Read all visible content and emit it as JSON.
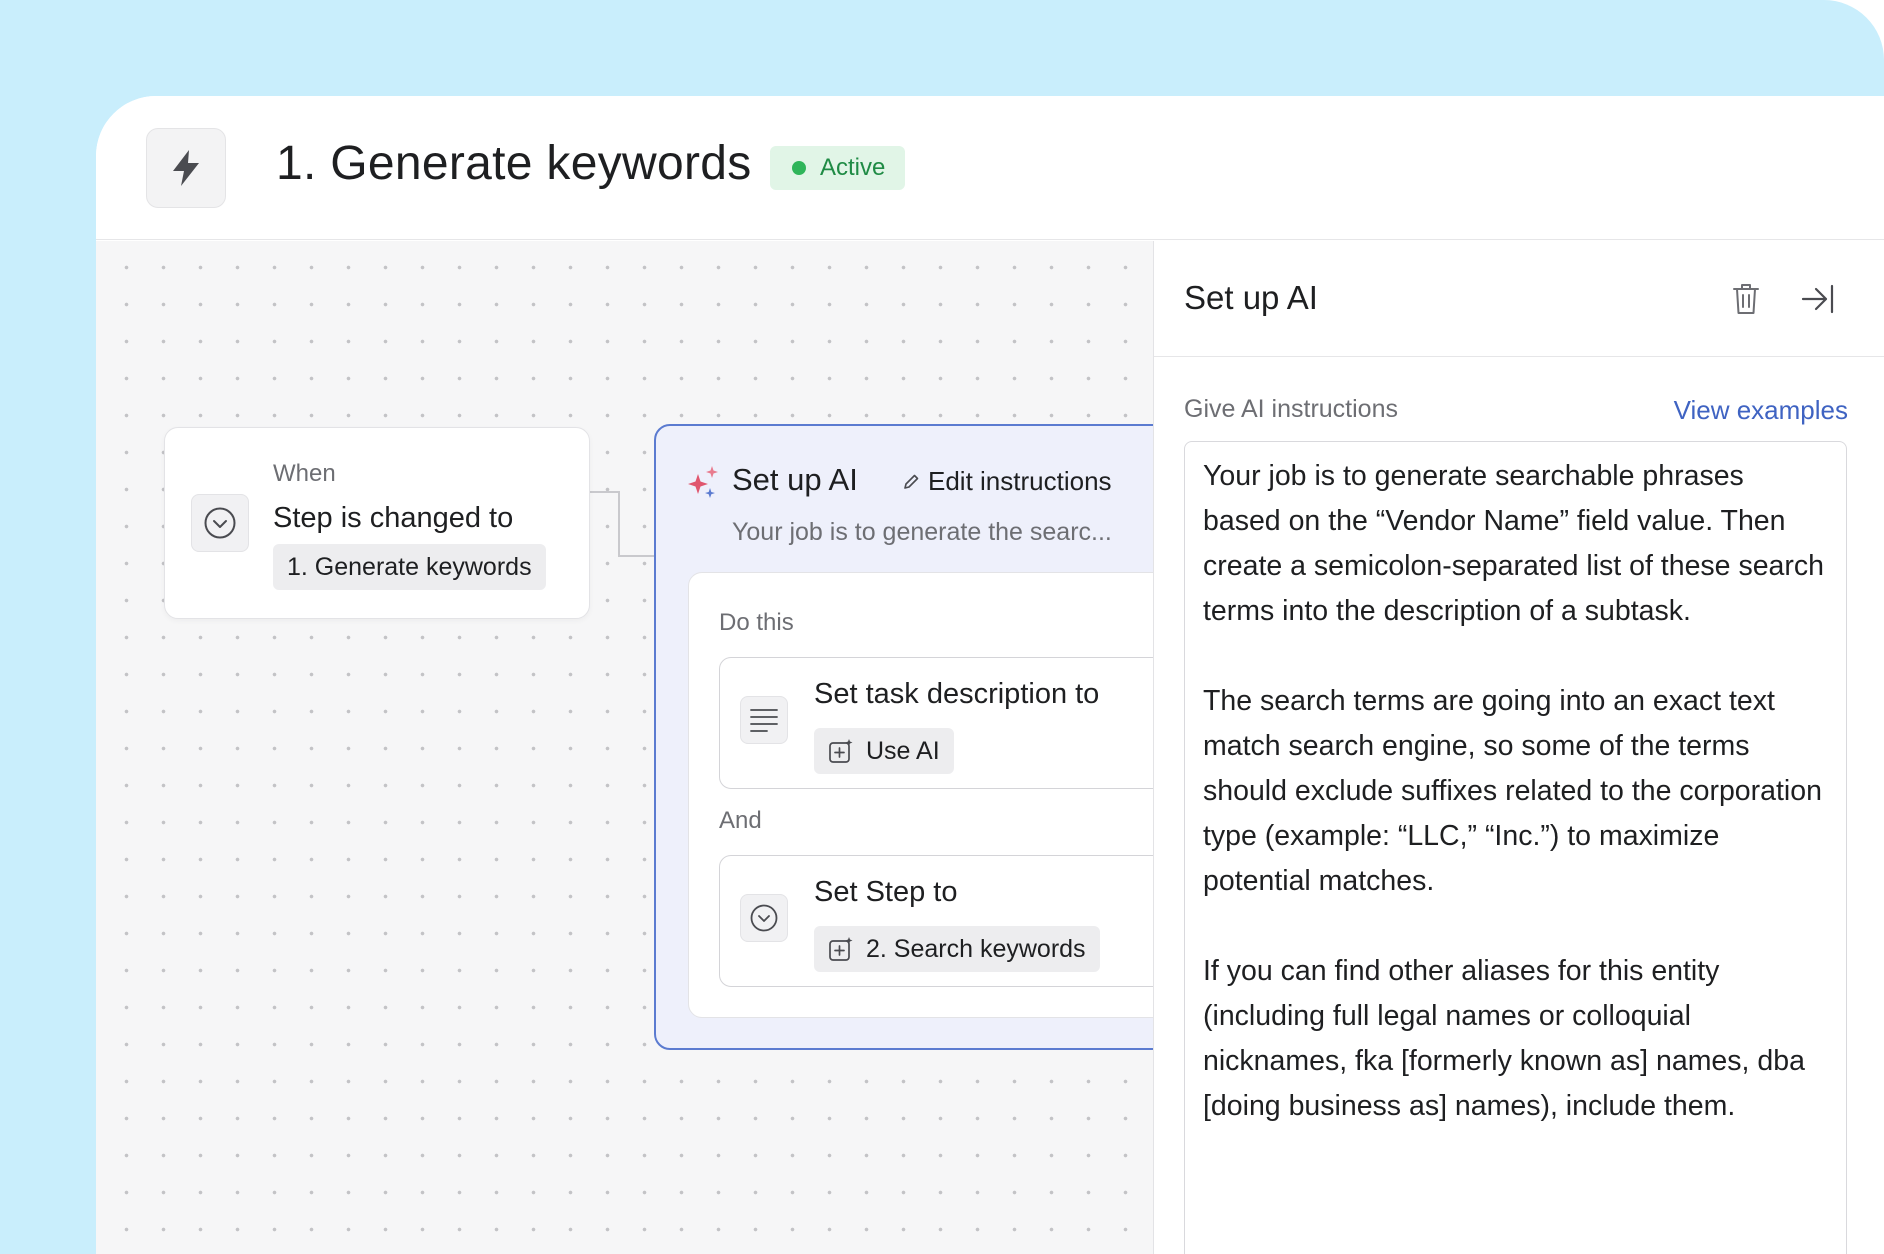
{
  "header": {
    "title": "1. Generate keywords",
    "status": "Active"
  },
  "trigger": {
    "when_label": "When",
    "condition": "Step is changed to",
    "value_chip": "1. Generate keywords"
  },
  "ai_step": {
    "title": "Set up AI",
    "edit_label": "Edit instructions",
    "preview": "Your job is to generate the searc...",
    "do_this_label": "Do this",
    "actions": [
      {
        "title": "Set task description to",
        "chip": "Use AI",
        "icon": "text-lines-icon"
      },
      {
        "title": "Set Step to",
        "chip": "2. Search keywords",
        "icon": "chevron-down-circle-icon"
      }
    ],
    "and_label": "And"
  },
  "panel": {
    "title": "Set up AI",
    "instructions_label": "Give AI instructions",
    "view_examples": "View examples",
    "instructions_text": "Your job is to generate searchable phrases based on the “Vendor Name” field value. Then create a semicolon-separated list of these search terms into the description of a subtask.\n\nThe search terms are going into an exact text match search engine, so some of the terms should exclude suffixes related to the corporation type (example: “LLC,” “Inc.”) to maximize potential matches.\n\nIf you can find other aliases for this entity (including full legal names or colloquial nicknames, fka [formerly known as] names, dba [doing business as] names), include them."
  },
  "colors": {
    "backdrop": "#c9eefc",
    "accent_blue": "#5b7bd0",
    "link_blue": "#3f63c2",
    "status_green": "#2fb55a",
    "status_bg": "#e1f5e7"
  }
}
